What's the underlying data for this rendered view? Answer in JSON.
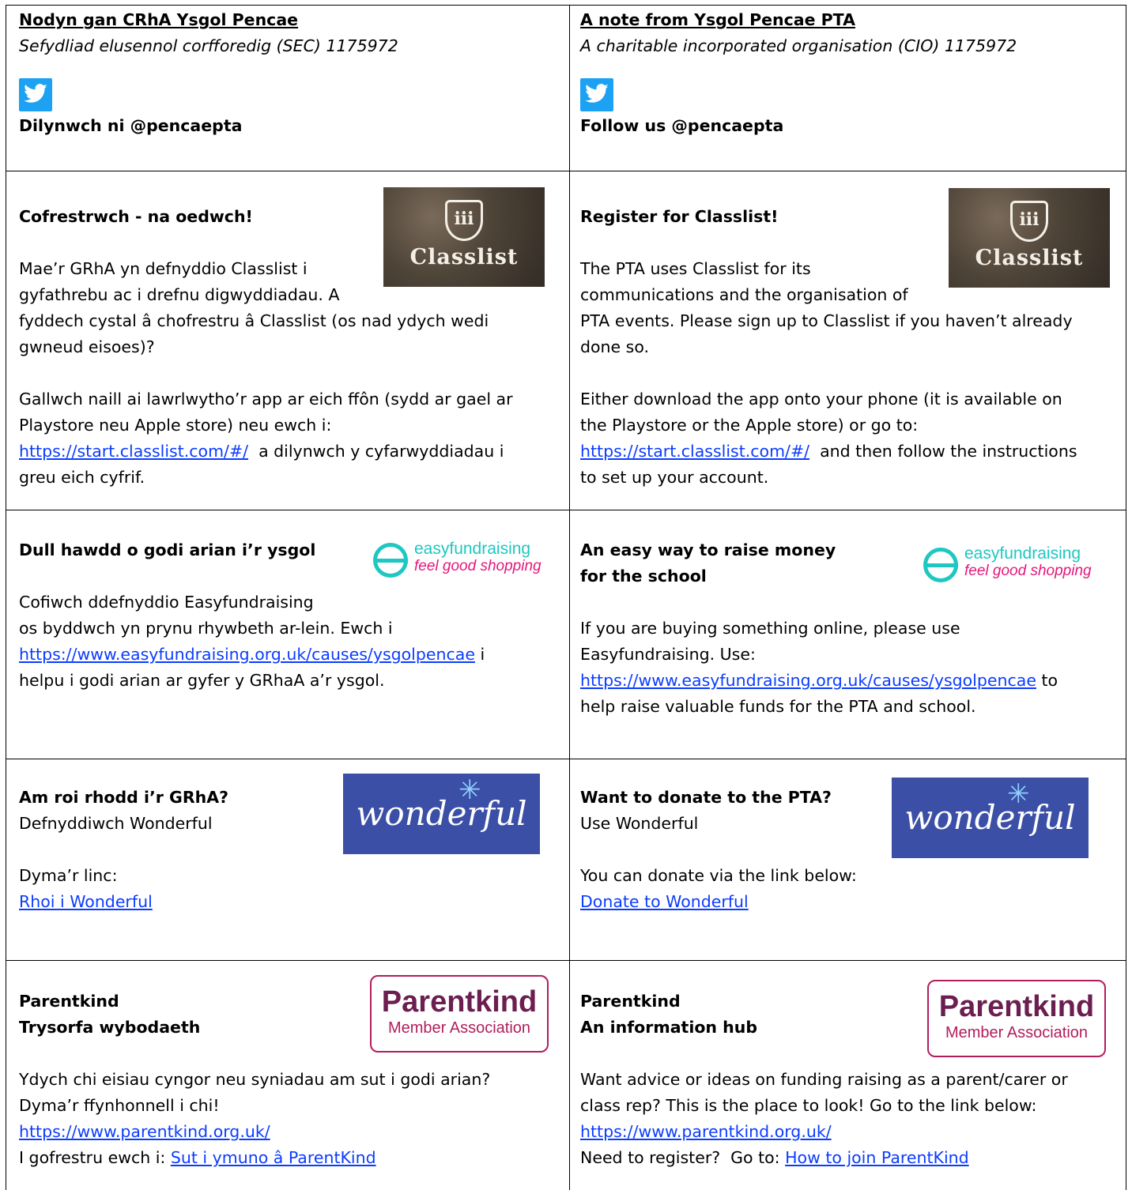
{
  "cy": {
    "header": {
      "title": "Nodyn gan CRhA Ysgol Pencae",
      "subtitle": "Sefydliad elusennol corfforedig (SEC) 1175972",
      "follow": "Dilynwch ni @pencaepta"
    },
    "classlist": {
      "heading": "Cofrestrwch - na oedwch!",
      "p1_l1": "Mae’r GRhA yn defnyddio Classlist i",
      "p1_l2": "gyfathrebu ac i drefnu digwyddiadau.  A",
      "p1_l3": "fyddech cystal â chofrestru â Classlist (os nad ydych wedi",
      "p1_l4": "gwneud eisoes)?",
      "p2_l1": "Gallwch naill ai lawrlwytho’r app ar eich ffôn (sydd ar gael ar",
      "p2_l2": "Playstore neu Apple store) neu ewch i:",
      "link": "https://start.classlist.com/#/",
      "p2_l3_rest": "  a dilynwch y cyfarwyddiadau i",
      "p2_l4": "greu eich cyfrif."
    },
    "easy": {
      "heading": "Dull hawdd o godi arian i’r ysgol",
      "l1": "Cofiwch ddefnyddio Easyfundraising",
      "l2": "os byddwch yn prynu rhywbeth ar-lein. Ewch i",
      "link": "https://www.easyfundraising.org.uk/causes/ysgolpencae",
      "l3_rest": " i",
      "l4": "helpu i godi arian ar gyfer y GRhaA a’r ysgol."
    },
    "wonderful": {
      "heading": "Am roi rhodd i’r GRhA?",
      "sub": "Defnyddiwch Wonderful",
      "l1": "Dyma’r linc:",
      "link": "Rhoi i Wonderful"
    },
    "parentkind": {
      "h1": "Parentkind",
      "h2": "Trysorfa wybodaeth",
      "l1": "Ydych chi eisiau cyngor neu syniadau am sut i godi arian?",
      "l2": "Dyma’r ffynhonnell i chi!",
      "link": "https://www.parentkind.org.uk/",
      "l4_pre": "I gofrestru ewch i: ",
      "link2": "Sut i ymuno â ParentKind"
    }
  },
  "en": {
    "header": {
      "title": "A note from Ysgol Pencae PTA",
      "subtitle": "A charitable incorporated organisation (CIO) 1175972",
      "follow": "Follow us @pencaepta"
    },
    "classlist": {
      "heading": "Register for Classlist!",
      "p1_l1": "The PTA uses Classlist for its",
      "p1_l2": "communications and the organisation of",
      "p1_l3": "PTA events.  Please sign up to Classlist if you haven’t already",
      "p1_l4": "done so.",
      "p2_l1": "Either download the app onto your phone (it is available on",
      "p2_l2": "the Playstore or the Apple store) or go to:",
      "link": "https://start.classlist.com/#/",
      "p2_l3_rest": "  and then follow the instructions",
      "p2_l4": "to set up your account."
    },
    "easy": {
      "heading_l1": "An easy way to raise money",
      "heading_l2": "for the school",
      "l1": "If you are buying something online, please use",
      "l2": "Easyfundraising. Use:",
      "link": "https://www.easyfundraising.org.uk/causes/ysgolpencae",
      "l3_rest": " to",
      "l4": "help raise valuable funds for the PTA and school."
    },
    "wonderful": {
      "heading": "Want to donate to the PTA?",
      "sub": "Use Wonderful",
      "l1": "You can donate via the link below:",
      "link": "Donate to Wonderful"
    },
    "parentkind": {
      "h1": "Parentkind",
      "h2": "An information hub",
      "l1": "Want advice or ideas on funding raising as a parent/carer or",
      "l2": "class rep?  This is the place to look!  Go to the link below:",
      "link": "https://www.parentkind.org.uk/",
      "l4_pre": "Need to register?  Go to: ",
      "link2": "How to join ParentKind"
    }
  },
  "logos": {
    "classlist_word": "Classlist",
    "classlist_shield": "iii",
    "easy_top": "easyfundraising",
    "easy_bottom": "feel good shopping",
    "wonderful_word": "wonderful",
    "parentkind_word": "Parentkind",
    "parentkind_sub": "Member Association"
  },
  "colors": {
    "link": "#0b3cff",
    "twitter": "#1da1f2",
    "easy_teal": "#1ec7c2",
    "easy_pink": "#e5177b",
    "wonderful_bg": "#3b4fa6",
    "parentkind": "#6b1e4f"
  },
  "icons": [
    "twitter-icon"
  ]
}
